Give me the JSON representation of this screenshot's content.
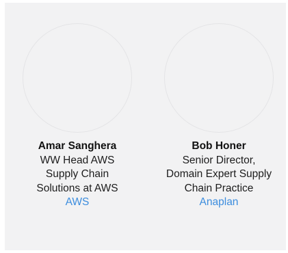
{
  "speakers": [
    {
      "name": "Amar Sanghera",
      "role": "WW Head AWS Supply Chain Solutions at AWS",
      "company": "AWS"
    },
    {
      "name": "Bob Honer",
      "role": "Senior Director, Domain Expert Supply Chain Practice",
      "company": "Anaplan"
    }
  ]
}
